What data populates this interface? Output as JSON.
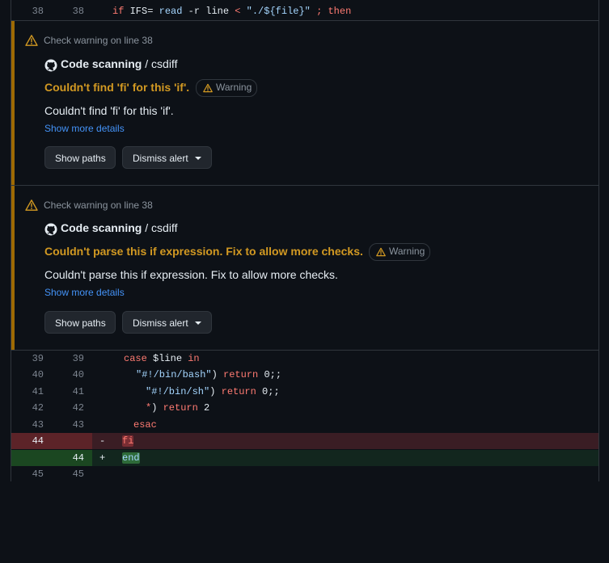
{
  "code_top": {
    "old": "38",
    "new": "38",
    "tokens": [
      {
        "t": "if",
        "c": "kw"
      },
      {
        "t": " IFS= ",
        "c": "plain"
      },
      {
        "t": "read",
        "c": "str"
      },
      {
        "t": " -r line ",
        "c": "plain"
      },
      {
        "t": "<",
        "c": "kw"
      },
      {
        "t": " ",
        "c": "plain"
      },
      {
        "t": "\"./${file}\"",
        "c": "str"
      },
      {
        "t": " ",
        "c": "plain"
      },
      {
        "t": ";",
        "c": "kw"
      },
      {
        "t": " ",
        "c": "plain"
      },
      {
        "t": "then",
        "c": "kw"
      }
    ]
  },
  "alerts": [
    {
      "header": "Check warning on line 38",
      "tool": "Code scanning",
      "tool_sep": " / ",
      "rule": "csdiff",
      "title": "Couldn't find 'fi' for this 'if'.",
      "badge": "Warning",
      "message": "Couldn't find 'fi' for this 'if'.",
      "more_link": "Show more details",
      "show_paths": "Show paths",
      "dismiss": "Dismiss alert"
    },
    {
      "header": "Check warning on line 38",
      "tool": "Code scanning",
      "tool_sep": " / ",
      "rule": "csdiff",
      "title": "Couldn't parse this if expression. Fix to allow more checks.",
      "badge": "Warning",
      "message": "Couldn't parse this if expression. Fix to allow more checks.",
      "more_link": "Show more details",
      "show_paths": "Show paths",
      "dismiss": "Dismiss alert"
    }
  ],
  "code_rows": [
    {
      "old": "39",
      "new": "39",
      "marker": "",
      "type": "context",
      "tokens": [
        {
          "t": "case",
          "c": "kw"
        },
        {
          "t": " $line ",
          "c": "plain"
        },
        {
          "t": "in",
          "c": "kw"
        }
      ]
    },
    {
      "old": "40",
      "new": "40",
      "marker": "",
      "type": "context",
      "tokens": [
        {
          "t": "\"#!/bin/bash\"",
          "c": "str"
        },
        {
          "t": ") ",
          "c": "plain"
        },
        {
          "t": "return",
          "c": "kw"
        },
        {
          "t": " 0;;",
          "c": "plain"
        }
      ]
    },
    {
      "old": "41",
      "new": "41",
      "marker": "",
      "type": "context",
      "tokens": [
        {
          "t": "\"#!/bin/sh\"",
          "c": "str"
        },
        {
          "t": ") ",
          "c": "plain"
        },
        {
          "t": "return",
          "c": "kw"
        },
        {
          "t": " 0;;",
          "c": "plain"
        }
      ]
    },
    {
      "old": "42",
      "new": "42",
      "marker": "",
      "type": "context",
      "tokens": [
        {
          "t": "*",
          "c": "kw"
        },
        {
          "t": ") ",
          "c": "plain"
        },
        {
          "t": "return",
          "c": "kw"
        },
        {
          "t": " 2",
          "c": "plain"
        }
      ]
    },
    {
      "old": "43",
      "new": "43",
      "marker": "",
      "type": "context",
      "tokens": [
        {
          "t": "esac",
          "c": "kw"
        }
      ]
    },
    {
      "old": "44",
      "new": "",
      "marker": "-",
      "type": "del",
      "tokens": [
        {
          "t": "fi",
          "c": "kw"
        }
      ]
    },
    {
      "old": "",
      "new": "44",
      "marker": "+",
      "type": "add",
      "tokens": [
        {
          "t": "end",
          "c": "str"
        }
      ]
    },
    {
      "old": "45",
      "new": "45",
      "marker": "",
      "type": "context",
      "tokens": []
    }
  ],
  "colors": {
    "warning": "#d29922",
    "link": "#4493f8",
    "deleted_bg": "#3a1d24",
    "added_bg": "#12261e"
  },
  "icons": {
    "alert": "alert-triangle-icon",
    "tool": "github-mark-icon",
    "menu": "triangle-down-icon"
  }
}
